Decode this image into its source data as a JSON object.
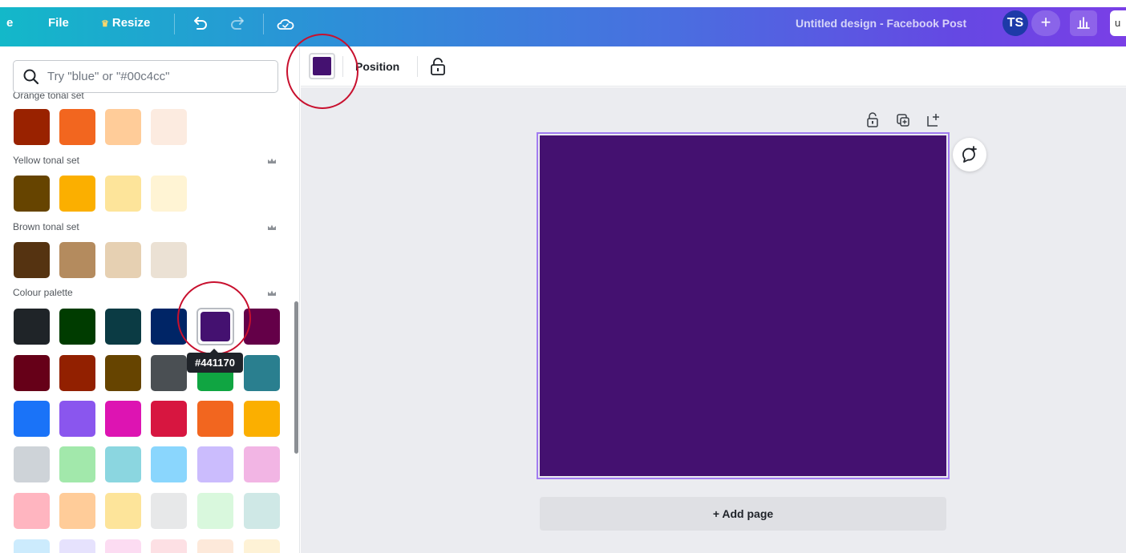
{
  "topbar": {
    "home_partial": "e",
    "file_label": "File",
    "resize_label": "Resize",
    "design_title": "Untitled design - Facebook Post",
    "avatar_initials": "TS",
    "add_label": "+",
    "share_partial": "u"
  },
  "panel": {
    "search": {
      "placeholder": "Try \"blue\" or \"#00c4cc\""
    },
    "sections": [
      {
        "label": "Orange tonal set",
        "swatches": [
          "#992200",
          "#f2661f",
          "#ffcc99",
          "#fcebe0"
        ]
      },
      {
        "label": "Yellow tonal set",
        "swatches": [
          "#664400",
          "#fbaf00",
          "#fde49a",
          "#fff4d4"
        ]
      },
      {
        "label": "Brown tonal set",
        "swatches": [
          "#553311",
          "#b48b5e",
          "#e6d0b2",
          "#ebe1d4"
        ]
      },
      {
        "label": "Colour palette"
      }
    ],
    "palette_rows": [
      [
        "#1f2428",
        "#003c00",
        "#0b3b44",
        "#002566",
        "#441170",
        "#640048"
      ],
      [
        "#660018",
        "#922000",
        "#664400",
        "#4a4f53",
        "#10a542",
        "#2a7f8f"
      ],
      [
        "#1a73f8",
        "#8a56ee",
        "#dd14b2",
        "#d71640",
        "#f2661f",
        "#fbaf00"
      ],
      [
        "#ced3d8",
        "#a2e8ab",
        "#8bd6e0",
        "#8ad6fd",
        "#cbbcfd",
        "#f2b5e4"
      ],
      [
        "#ffb5c0",
        "#ffcc99",
        "#fde49a",
        "#e7e8e9",
        "#d9f8dd",
        "#cfe8e6"
      ],
      [
        "#ccebfd",
        "#e6e2fd",
        "#fcdcf2",
        "#fde0e4",
        "#fde9da",
        "#fef2d6"
      ]
    ],
    "selected_hex": "#441170"
  },
  "toolbar": {
    "color_value": "#441170",
    "position_label": "Position"
  },
  "canvas": {
    "fill": "#441170",
    "add_page_label": "+ Add page"
  }
}
